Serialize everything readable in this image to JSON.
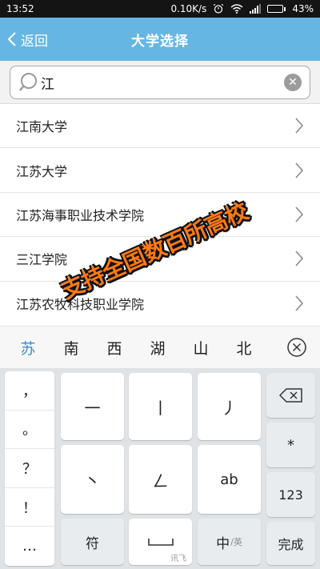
{
  "status_bar": {
    "time": "13:52",
    "speed": "0.10K/s",
    "battery": "43%",
    "battery_level": 0.43
  },
  "header": {
    "back_label": "返回",
    "title": "大学选择"
  },
  "search": {
    "value": "江",
    "placeholder": ""
  },
  "results": [
    {
      "label": "江南大学"
    },
    {
      "label": "江苏大学"
    },
    {
      "label": "江苏海事职业技术学院"
    },
    {
      "label": "三江学院"
    },
    {
      "label": "江苏农牧科技职业学院"
    }
  ],
  "promo": {
    "text": "支持全国数百所高校"
  },
  "candidates": [
    "苏",
    "南",
    "西",
    "湖",
    "山",
    "北"
  ],
  "keyboard": {
    "punctuation": [
      "，",
      "。",
      "？",
      "！",
      "…"
    ],
    "strokes": {
      "heng": "一",
      "shu": "丨",
      "pie": "丿",
      "dian": "丶",
      "zhe": "ㄥ",
      "ab": "ab"
    },
    "right_column": {
      "star": "*",
      "numbers": "123",
      "done": "完成"
    },
    "symbol": "符",
    "space": "␣",
    "lang": {
      "main": "中",
      "sub": "/英"
    },
    "brand": "讯飞"
  },
  "colors": {
    "header_bg": "#66b6e4",
    "promo": "#ff7a14",
    "candidate_active": "#3a8ed0"
  }
}
